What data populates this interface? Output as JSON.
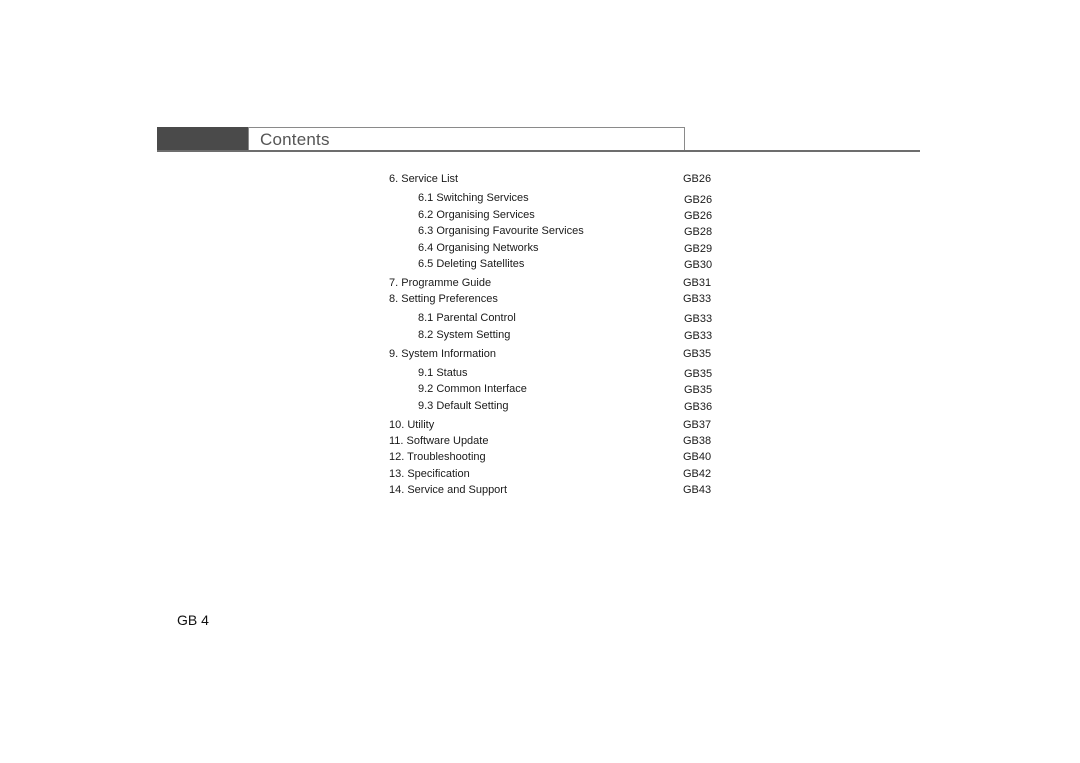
{
  "header": {
    "title": "Contents"
  },
  "toc": [
    {
      "label": "6. Service List",
      "page": "GB26",
      "level": 1
    },
    {
      "label": "6.1 Switching Services",
      "page": "GB26",
      "level": 2
    },
    {
      "label": "6.2 Organising Services",
      "page": "GB26",
      "level": 2
    },
    {
      "label": "6.3 Organising Favourite Services",
      "page": "GB28",
      "level": 2
    },
    {
      "label": "6.4 Organising Networks",
      "page": "GB29",
      "level": 2
    },
    {
      "label": "6.5 Deleting Satellites",
      "page": "GB30",
      "level": 2
    },
    {
      "label": "7. Programme Guide",
      "page": "GB31",
      "level": 1
    },
    {
      "label": "8. Setting Preferences",
      "page": "GB33",
      "level": 1
    },
    {
      "label": "8.1 Parental Control",
      "page": "GB33",
      "level": 2
    },
    {
      "label": "8.2 System Setting",
      "page": "GB33",
      "level": 2
    },
    {
      "label": "9. System Information",
      "page": "GB35",
      "level": 1
    },
    {
      "label": "9.1 Status",
      "page": "GB35",
      "level": 2
    },
    {
      "label": "9.2 Common Interface",
      "page": "GB35",
      "level": 2
    },
    {
      "label": "9.3 Default Setting",
      "page": "GB36",
      "level": 2
    },
    {
      "label": "10. Utility",
      "page": "GB37",
      "level": 1
    },
    {
      "label": "11. Software Update",
      "page": "GB38",
      "level": 1
    },
    {
      "label": "12. Troubleshooting",
      "page": "GB40",
      "level": 1
    },
    {
      "label": "13. Specification",
      "page": "GB42",
      "level": 1
    },
    {
      "label": "14. Service and Support",
      "page": "GB43",
      "level": 1
    }
  ],
  "footer": {
    "page_number": "GB 4"
  }
}
